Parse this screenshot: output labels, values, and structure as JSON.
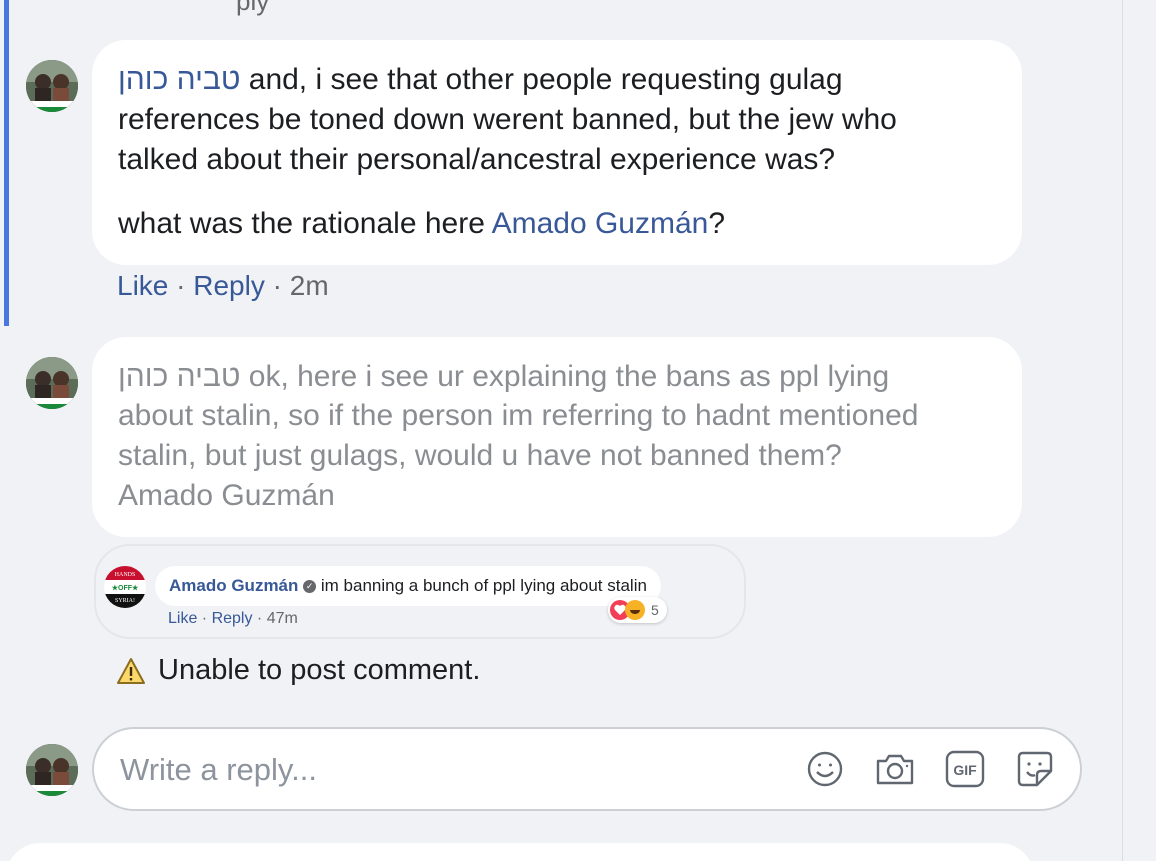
{
  "top_cut_text": "ply",
  "comments": [
    {
      "author": "טביה כוהן",
      "text_line_1": " and, i see that other people requesting gulag",
      "text_line_2": "references be toned down werent banned, but the jew who",
      "text_line_3": "talked about their personal/ancestral experience was?",
      "text_line_4_prefix": "what was the rationale here ",
      "mention": "Amado Guzmán",
      "text_line_4_suffix": "?",
      "like_label": "Like",
      "reply_label": "Reply",
      "time": "2m"
    },
    {
      "author": "טביה כוהן",
      "text_line_1": " ok, here i see ur explaining the bans as ppl lying",
      "text_line_2": "about stalin, so if the person im referring to hadnt mentioned",
      "text_line_3": "stalin, but just gulags, would u have not banned them?",
      "text_line_4": "Amado Guzmán"
    }
  ],
  "quoted": {
    "author": "Amado Guzmán",
    "text": "im banning a bunch of ppl lying about stalin",
    "like_label": "Like",
    "reply_label": "Reply",
    "time": "47m",
    "reaction_count": "5",
    "avatar_text_top": "HANDS",
    "avatar_text_mid": "★OFF★",
    "avatar_text_bottom": "SYRIA!"
  },
  "error_message": "Unable to post comment.",
  "reply_box": {
    "placeholder": "Write a reply...",
    "icons": [
      "emoji-icon",
      "camera-icon",
      "gif-icon",
      "sticker-icon"
    ],
    "gif_label": "GIF"
  },
  "colors": {
    "link": "#385898",
    "thread_bar": "#4a76e0",
    "muted": "#8a8d91"
  }
}
